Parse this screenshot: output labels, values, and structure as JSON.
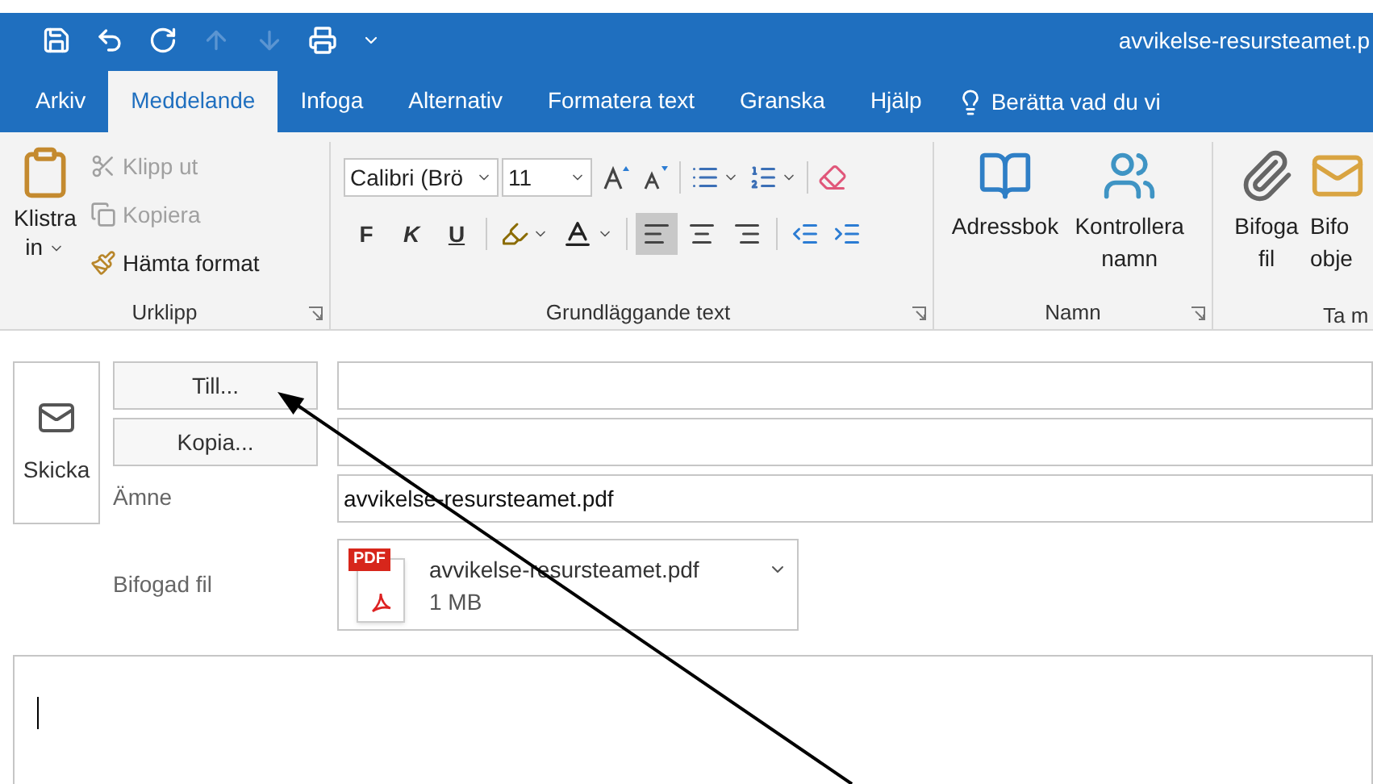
{
  "title_bar": {
    "quick_access": [
      {
        "kind": "save",
        "disabled": false
      },
      {
        "kind": "undo",
        "disabled": false
      },
      {
        "kind": "redo",
        "disabled": false
      },
      {
        "kind": "up",
        "disabled": true
      },
      {
        "kind": "down",
        "disabled": true
      },
      {
        "kind": "print",
        "disabled": false
      },
      {
        "kind": "customize",
        "disabled": false
      }
    ],
    "title": "avvikelse-resursteamet.p"
  },
  "tabs": [
    {
      "label": "Arkiv",
      "selected": false
    },
    {
      "label": "Meddelande",
      "selected": true
    },
    {
      "label": "Infoga",
      "selected": false
    },
    {
      "label": "Alternativ",
      "selected": false
    },
    {
      "label": "Formatera text",
      "selected": false
    },
    {
      "label": "Granska",
      "selected": false
    },
    {
      "label": "Hjälp",
      "selected": false
    }
  ],
  "tell_me": "Berätta vad du vi",
  "ribbon": {
    "clipboard": {
      "label": "Urklipp",
      "paste": "Klistra in",
      "items": [
        {
          "kind": "cut",
          "label": "Klipp ut",
          "disabled": true
        },
        {
          "kind": "copy",
          "label": "Kopiera",
          "disabled": true
        },
        {
          "kind": "format_painter",
          "label": "Hämta format",
          "disabled": false
        }
      ]
    },
    "basic_text": {
      "label": "Grundläggande text",
      "font": "Calibri (Brö",
      "size": "11",
      "styles": [
        {
          "kind": "bold",
          "label": "F"
        },
        {
          "kind": "italic",
          "label": "K"
        },
        {
          "kind": "underline",
          "label": "U"
        }
      ],
      "alignments": [
        {
          "kind": "left",
          "selected": true
        },
        {
          "kind": "center",
          "selected": false
        },
        {
          "kind": "right",
          "selected": false
        }
      ]
    },
    "names": {
      "label": "Namn",
      "buttons": [
        {
          "kind": "address_book",
          "label": "Adressbok"
        },
        {
          "kind": "check_names",
          "label": "Kontrollera namn"
        }
      ]
    },
    "include": {
      "label": "Ta m",
      "buttons": [
        {
          "kind": "attach_file",
          "label": "Bifoga fil"
        },
        {
          "kind": "attach_item",
          "label": "Bifo obje"
        }
      ]
    }
  },
  "compose": {
    "send": "Skicka",
    "to_button": "Till...",
    "cc_button": "Kopia...",
    "subject_label": "Ämne",
    "subject": "avvikelse-resursteamet.pdf",
    "attachment_label": "Bifogad fil",
    "attachment": {
      "badge": "PDF",
      "name": "avvikelse-resursteamet.pdf",
      "size": "1 MB"
    }
  }
}
